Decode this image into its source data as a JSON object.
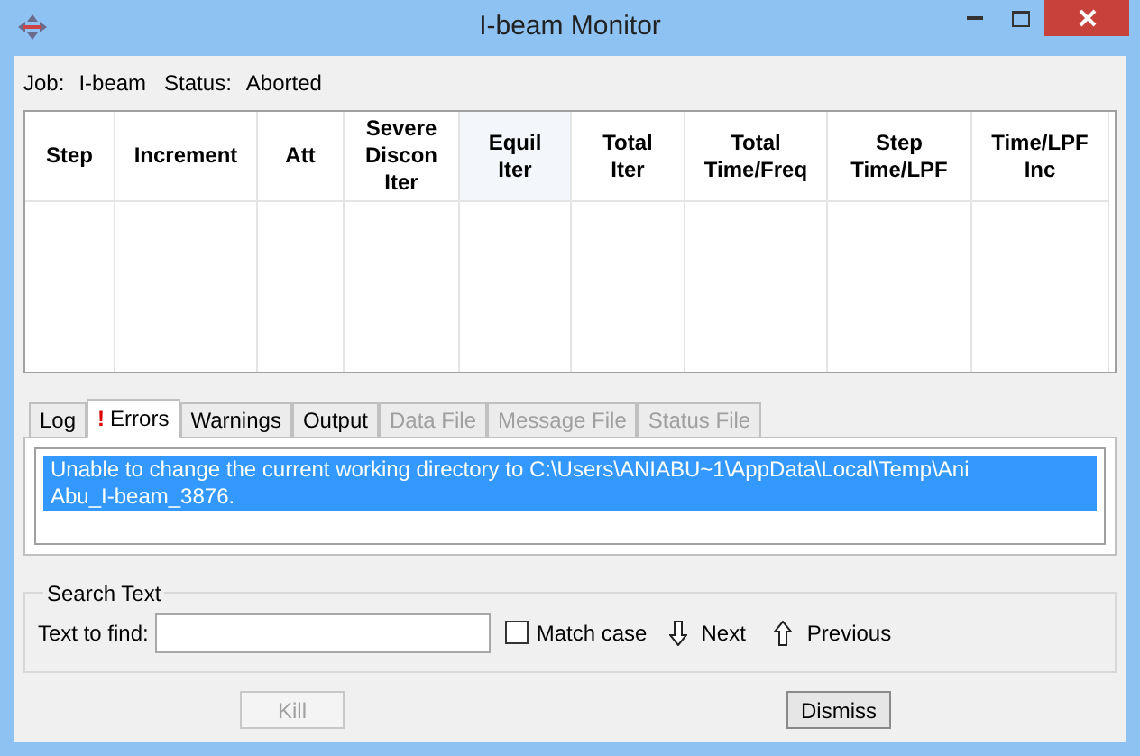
{
  "window": {
    "title": "I-beam Monitor"
  },
  "job": {
    "job_label": "Job:",
    "job_value": "I-beam",
    "status_label": "Status:",
    "status_value": "Aborted"
  },
  "table": {
    "columns": [
      {
        "label": "Step",
        "selected": false
      },
      {
        "label": "Increment",
        "selected": false
      },
      {
        "label": "Att",
        "selected": false
      },
      {
        "label": "Severe Discon Iter",
        "selected": false
      },
      {
        "label": "Equil Iter",
        "selected": true
      },
      {
        "label": "Total Iter",
        "selected": false
      },
      {
        "label": "Total Time/Freq",
        "selected": false
      },
      {
        "label": "Step Time/LPF",
        "selected": false
      },
      {
        "label": "Time/LPF Inc",
        "selected": false
      }
    ]
  },
  "tabs": [
    {
      "label": "Log",
      "selected": false,
      "disabled": false,
      "alert": false
    },
    {
      "label": "Errors",
      "selected": true,
      "disabled": false,
      "alert": true,
      "alert_mark": "!"
    },
    {
      "label": "Warnings",
      "selected": false,
      "disabled": false,
      "alert": false
    },
    {
      "label": "Output",
      "selected": false,
      "disabled": false,
      "alert": false
    },
    {
      "label": "Data File",
      "selected": false,
      "disabled": true,
      "alert": false
    },
    {
      "label": "Message File",
      "selected": false,
      "disabled": true,
      "alert": false
    },
    {
      "label": "Status File",
      "selected": false,
      "disabled": true,
      "alert": false
    }
  ],
  "message": {
    "lines": [
      "Unable to change the current working directory to C:\\Users\\ANIABU~1\\AppData\\Local\\Temp\\Ani",
      "Abu_I-beam_3876."
    ],
    "selected": true
  },
  "search": {
    "title": "Search Text",
    "label": "Text to find:",
    "match_case": {
      "label": "Match case",
      "checked": false
    },
    "next": "Next",
    "previous": "Previous"
  },
  "buttons": [
    {
      "label": "Kill",
      "disabled": true
    },
    {
      "label": "Dismiss",
      "disabled": false
    }
  ]
}
